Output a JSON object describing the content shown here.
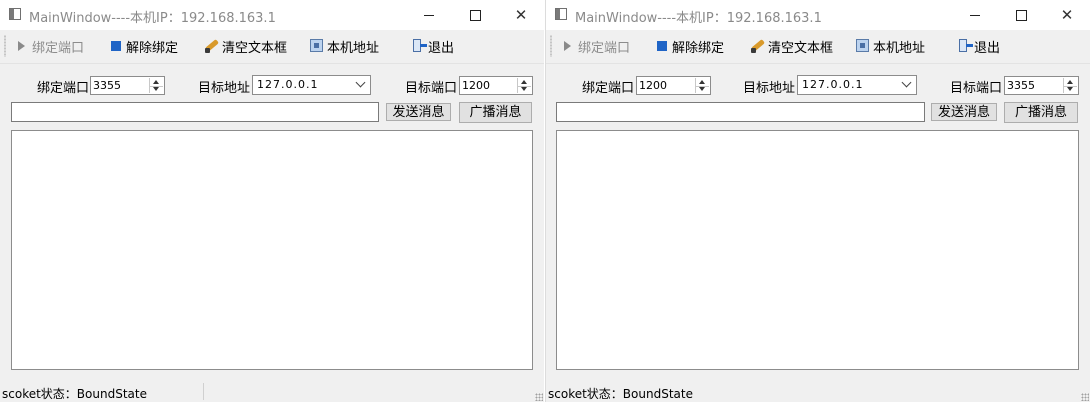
{
  "windows": [
    {
      "title": "MainWindow----本机IP：192.168.163.1",
      "toolbar": {
        "bind_port": "绑定端口",
        "unbind": "解除绑定",
        "clear_text": "清空文本框",
        "local_address": "本机地址",
        "exit": "退出"
      },
      "form": {
        "bind_port_label": "绑定端口",
        "bind_port_value": "3355",
        "target_address_label": "目标地址",
        "target_address_value": "127.0.0.1",
        "target_port_label": "目标端口",
        "target_port_value": "1200",
        "message_value": "",
        "send_button": "发送消息",
        "broadcast_button": "广播消息"
      },
      "status": "scoket状态：BoundState"
    },
    {
      "title": "MainWindow----本机IP：192.168.163.1",
      "toolbar": {
        "bind_port": "绑定端口",
        "unbind": "解除绑定",
        "clear_text": "清空文本框",
        "local_address": "本机地址",
        "exit": "退出"
      },
      "form": {
        "bind_port_label": "绑定端口",
        "bind_port_value": "1200",
        "target_address_label": "目标地址",
        "target_address_value": "127.0.0.1",
        "target_port_label": "目标端口",
        "target_port_value": "3355",
        "message_value": "",
        "send_button": "发送消息",
        "broadcast_button": "广播消息"
      },
      "status": "scoket状态：BoundState"
    }
  ],
  "icons": {
    "app": "window-icon",
    "bind": "play-triangle-icon",
    "unbind": "stop-square-icon",
    "clear": "broom-icon",
    "address": "network-icon",
    "exit": "exit-door-icon"
  },
  "colors": {
    "accent": "#1f64c6",
    "window_bg": "#f0f0f0",
    "disabled_text": "#8c8c8c"
  }
}
